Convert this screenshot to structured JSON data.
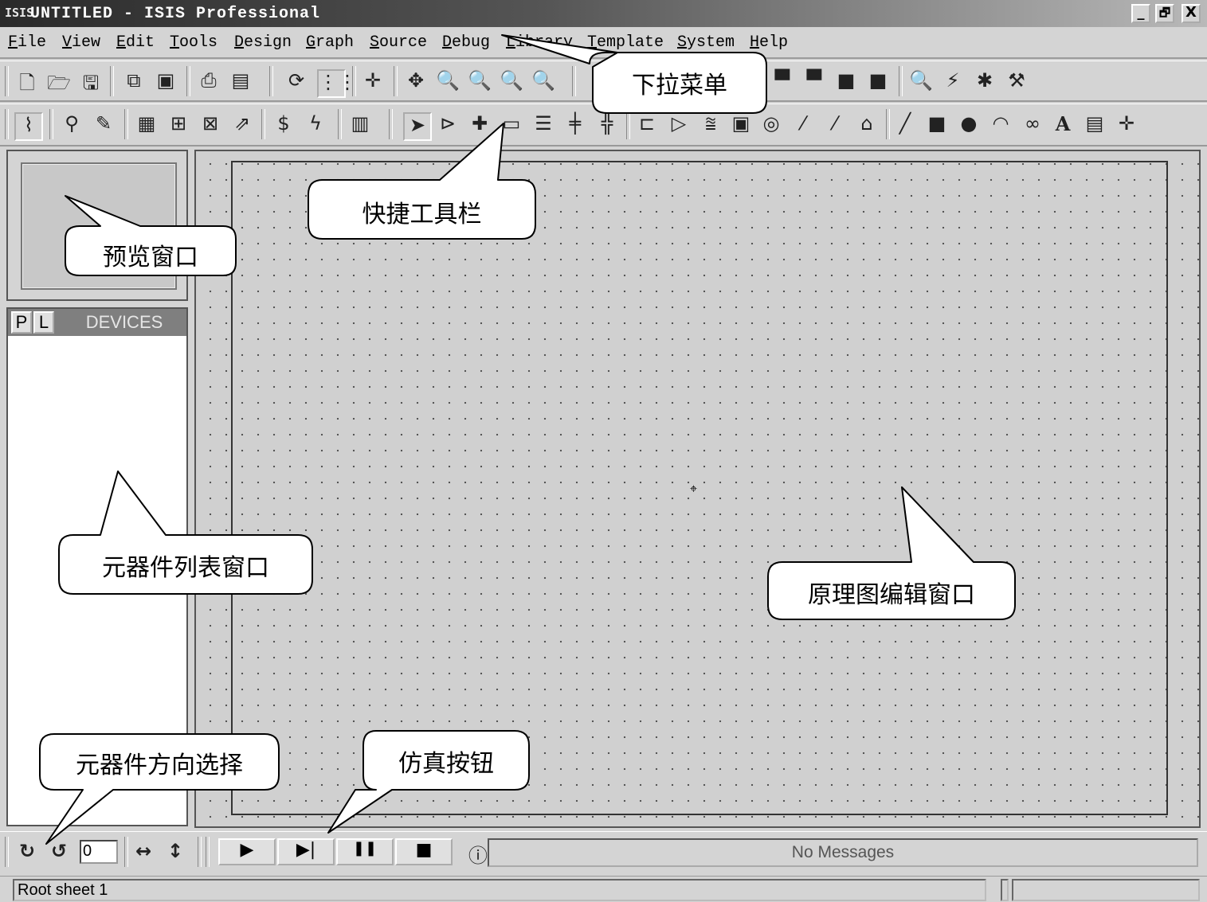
{
  "window": {
    "logo": "ISIS",
    "title": "UNTITLED - ISIS Professional",
    "controls": [
      "_",
      "🗗",
      "X"
    ]
  },
  "menu": [
    "File",
    "View",
    "Edit",
    "Tools",
    "Design",
    "Graph",
    "Source",
    "Debug",
    "Library",
    "Template",
    "System",
    "Help"
  ],
  "toolbar1_icons": [
    "new-file-icon",
    "open-folder-icon",
    "save-icon",
    "import-icon",
    "export-icon",
    "print-icon",
    "print-area-icon",
    "refresh-icon",
    "grid-icon",
    "origin-icon",
    "pan-icon",
    "zoom-in-icon",
    "zoom-out-icon",
    "zoom-all-icon",
    "zoom-area-icon"
  ],
  "toolbar1_right_icons": [
    "block-copy-icon",
    "block-move-icon",
    "block-rotate-icon",
    "block-delete-icon",
    "search-tag-icon",
    "wire-autoroute-icon",
    "make-device-icon",
    "decompose-icon"
  ],
  "toolbar2_icons": [
    "wire-autoroute-icon",
    "search-icon",
    "property-tool-icon",
    "netlist-icon",
    "new-sheet-icon",
    "delete-sheet-icon",
    "goto-sheet-icon",
    "bill-of-materials-icon",
    "electrical-check-icon",
    "ares-icon",
    "select-arrow-icon",
    "component-icon",
    "junction-icon",
    "wire-label-icon",
    "text-script-icon",
    "bus-icon",
    "subcircuit-icon",
    "terminal-icon",
    "device-pin-icon",
    "graph-icon",
    "tape-recorder-icon",
    "generator-icon",
    "voltage-probe-icon",
    "current-probe-icon",
    "virtual-instrument-icon",
    "line-icon",
    "box-icon",
    "circle-icon",
    "arc-icon",
    "path-icon",
    "text-icon",
    "symbol-icon",
    "marker-icon"
  ],
  "left": {
    "pick_label": "P",
    "library_label": "L",
    "devices_title": "DEVICES"
  },
  "bottom": {
    "rotation_value": "0",
    "sim_buttons": [
      "▶",
      "▶|",
      "❚❚",
      "■"
    ],
    "messages": "No Messages"
  },
  "status": {
    "sheet": "Root sheet 1"
  },
  "callouts": {
    "menu": "下拉菜单",
    "toolbar": "快捷工具栏",
    "preview": "预览窗口",
    "devices": "元器件列表窗口",
    "editor": "原理图编辑窗口",
    "orientation": "元器件方向选择",
    "simulation": "仿真按钮"
  }
}
